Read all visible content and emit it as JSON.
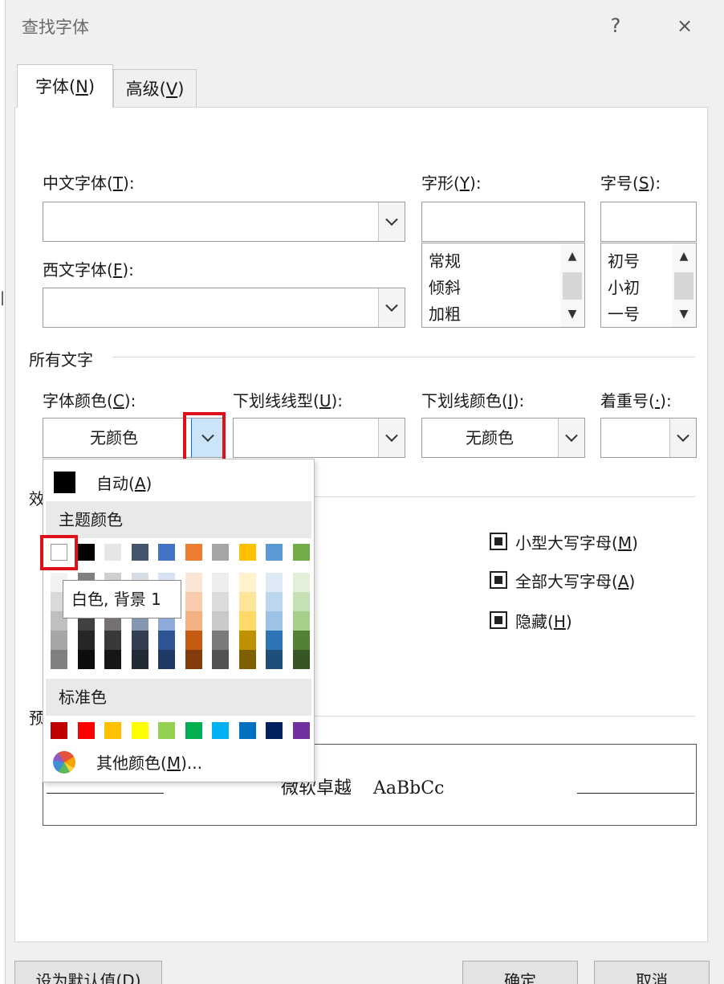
{
  "window": {
    "title": "查找字体",
    "help": "?",
    "close": "×"
  },
  "tabs": [
    {
      "label": "字体",
      "key": "N"
    },
    {
      "label": "高级",
      "key": "V"
    }
  ],
  "font": {
    "chinese_label": "中文字体",
    "chinese_key": "T",
    "western_label": "西文字体",
    "western_key": "F",
    "style_label": "字形",
    "style_key": "Y",
    "size_label": "字号",
    "size_key": "S",
    "styles": [
      "常规",
      "倾斜",
      "加粗"
    ],
    "sizes": [
      "初号",
      "小初",
      "一号"
    ]
  },
  "all_text": {
    "section": "所有文字",
    "color_label": "字体颜色",
    "color_key": "C",
    "color_value": "无颜色",
    "underline_label": "下划线线型",
    "underline_key": "U",
    "ucolor_label": "下划线颜色",
    "ucolor_key": "I",
    "ucolor_value": "无颜色",
    "emphasis_label": "着重号",
    "emphasis_key": "·"
  },
  "effects": {
    "section_partial": "效",
    "items": [
      {
        "label": "小型大写字母",
        "key": "M"
      },
      {
        "label": "全部大写字母",
        "key": "A"
      },
      {
        "label": "隐藏",
        "key": "H"
      }
    ]
  },
  "preview": {
    "section_partial": "预",
    "sample_cn": "微软卓越",
    "sample_en": "AaBbCc"
  },
  "color_popup": {
    "auto_label": "自动",
    "auto_key": "A",
    "theme_header": "主题颜色",
    "standard_header": "标准色",
    "more_label": "其他颜色",
    "more_key": "M",
    "more_suffix": "...",
    "theme_top": [
      "#ffffff",
      "#000000",
      "#e7e6e6",
      "#44546a",
      "#4472c4",
      "#ed7d31",
      "#a5a5a5",
      "#ffc000",
      "#5b9bd5",
      "#70ad47"
    ],
    "theme_shades": [
      [
        "#f2f2f2",
        "#d9d9d9",
        "#bfbfbf",
        "#a6a6a6",
        "#808080"
      ],
      [
        "#808080",
        "#595959",
        "#404040",
        "#262626",
        "#0d0d0d"
      ],
      [
        "#d0cece",
        "#aeaaaa",
        "#757171",
        "#3a3838",
        "#171616"
      ],
      [
        "#d6dce4",
        "#adb9ca",
        "#8497b0",
        "#333f4f",
        "#222a35"
      ],
      [
        "#d9e2f3",
        "#b4c6e7",
        "#8eaadb",
        "#2f5496",
        "#1f3864"
      ],
      [
        "#fbe5d5",
        "#f7cbac",
        "#f4b183",
        "#c55a11",
        "#833c0b"
      ],
      [
        "#ededed",
        "#dbdbdb",
        "#c9c9c9",
        "#7b7b7b",
        "#525252"
      ],
      [
        "#fff2cc",
        "#fee599",
        "#ffd965",
        "#bf9000",
        "#7f6000"
      ],
      [
        "#deebf6",
        "#bdd7ee",
        "#9cc3e5",
        "#2e75b5",
        "#1e4e79"
      ],
      [
        "#e2efd9",
        "#c5e0b3",
        "#a8d08d",
        "#538135",
        "#375623"
      ]
    ],
    "standard": [
      "#c00000",
      "#ff0000",
      "#ffc000",
      "#ffff00",
      "#92d050",
      "#00b050",
      "#00b0f0",
      "#0070c0",
      "#002060",
      "#7030a0"
    ],
    "tooltip": "白色, 背景 1"
  },
  "buttons": {
    "set_default": "设为默认值",
    "set_default_key": "D",
    "ok": "确定",
    "cancel": "取消"
  },
  "colors": {
    "highlight": "#e0101a",
    "dialog_bg": "#f0f0f0"
  }
}
